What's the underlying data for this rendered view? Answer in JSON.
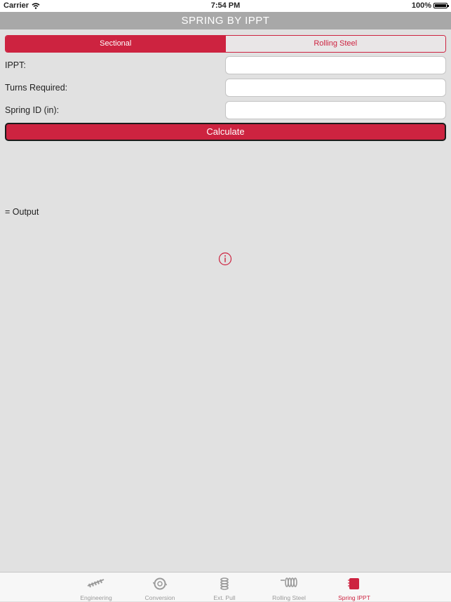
{
  "status_bar": {
    "carrier": "Carrier",
    "time": "7:54 PM",
    "battery": "100%"
  },
  "nav": {
    "title": "SPRING BY IPPT"
  },
  "segments": {
    "left": "Sectional",
    "right": "Rolling Steel",
    "selected": "Sectional"
  },
  "form": {
    "ippt_label": "IPPT:",
    "turns_label": "Turns Required:",
    "spring_id_label": "Spring ID (in):",
    "ippt_value": "",
    "turns_value": "",
    "spring_id_value": ""
  },
  "calculate_label": "Calculate",
  "output_label": "= Output",
  "tabs": [
    {
      "label": "Engineering",
      "icon": "spring-bar-icon"
    },
    {
      "label": "Conversion",
      "icon": "conversion-icon"
    },
    {
      "label": "Ext. Pull",
      "icon": "extension-spring-icon"
    },
    {
      "label": "Rolling Steel",
      "icon": "rolling-spring-icon"
    },
    {
      "label": "Spring IPPT",
      "icon": "spring-ippt-icon"
    }
  ],
  "selected_tab": "Spring IPPT",
  "colors": {
    "accent": "#cd2340",
    "background": "#e1e1e1",
    "nav": "#a8a8a8"
  }
}
